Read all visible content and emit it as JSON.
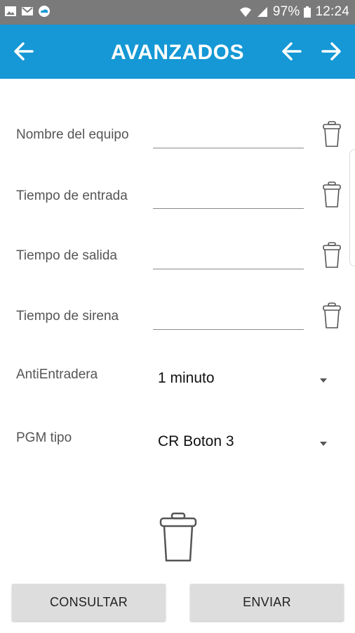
{
  "status_bar": {
    "left_icons": [
      "image-icon",
      "mail-icon",
      "cloud-icon"
    ],
    "battery": "97%",
    "time": "12:24"
  },
  "app_bar": {
    "title": "AVANZADOS",
    "color": "#1598d5"
  },
  "form": {
    "fields": [
      {
        "label": "Nombre del equipo",
        "value": ""
      },
      {
        "label": "Tiempo de entrada",
        "value": ""
      },
      {
        "label": "Tiempo de salida",
        "value": ""
      },
      {
        "label": "Tiempo de sirena",
        "value": ""
      }
    ],
    "selects": [
      {
        "label": "AntiEntradera",
        "value": "1 minuto"
      },
      {
        "label": "PGM tipo",
        "value": "CR Boton 3"
      }
    ]
  },
  "buttons": {
    "consultar": "CONSULTAR",
    "enviar": "ENVIAR"
  }
}
